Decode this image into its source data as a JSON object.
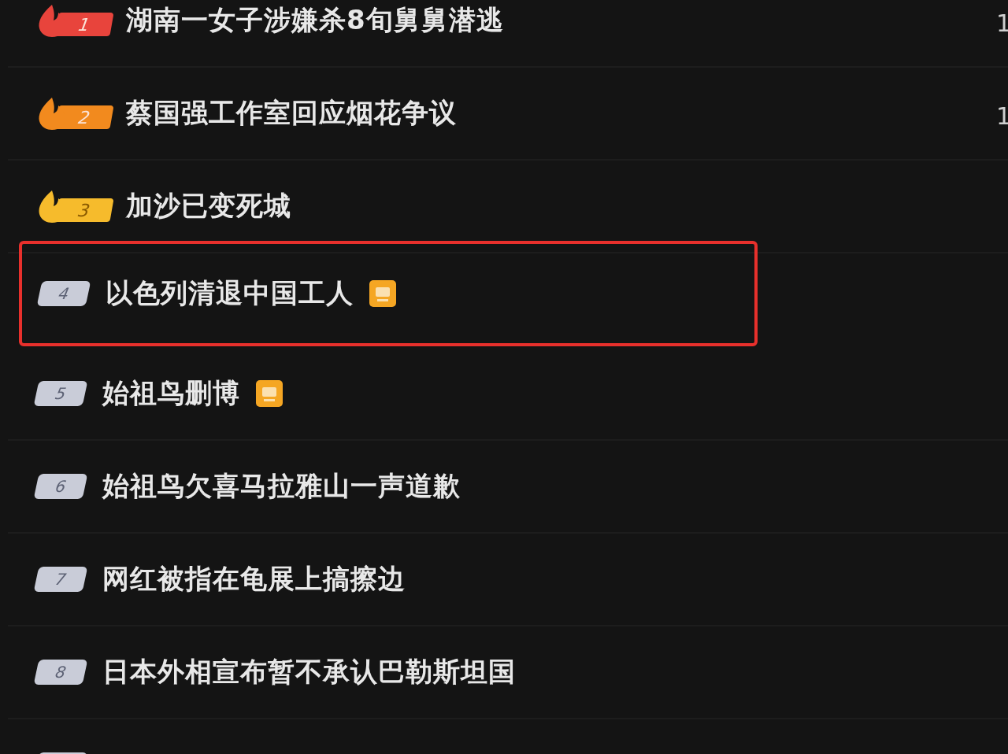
{
  "items": [
    {
      "kind": "fire",
      "rank": "1",
      "color": "#e8443c",
      "title": "湖南一女子涉嫌杀8旬舅舅潜逃",
      "tagged": false,
      "highlighted": false,
      "side_count": "1"
    },
    {
      "kind": "fire",
      "rank": "2",
      "color": "#f28a1e",
      "title": "蔡国强工作室回应烟花争议",
      "tagged": false,
      "highlighted": false,
      "side_count": "1"
    },
    {
      "kind": "fire",
      "rank": "3",
      "color": "#f6bb2c",
      "title": "加沙已变死城",
      "tagged": false,
      "highlighted": false
    },
    {
      "kind": "plain",
      "rank": "4",
      "title": "以色列清退中国工人",
      "tagged": true,
      "highlighted": true
    },
    {
      "kind": "plain",
      "rank": "5",
      "title": "始祖鸟删博",
      "tagged": true,
      "highlighted": false
    },
    {
      "kind": "plain",
      "rank": "6",
      "title": "始祖鸟欠喜马拉雅山一声道歉",
      "tagged": false,
      "highlighted": false
    },
    {
      "kind": "plain",
      "rank": "7",
      "title": "网红被指在龟展上搞擦边",
      "tagged": false,
      "highlighted": false
    },
    {
      "kind": "plain",
      "rank": "8",
      "title": "日本外相宣布暂不承认巴勒斯坦国",
      "tagged": false,
      "highlighted": false
    },
    {
      "kind": "plain",
      "tagged": false,
      "highlighted": false
    }
  ]
}
